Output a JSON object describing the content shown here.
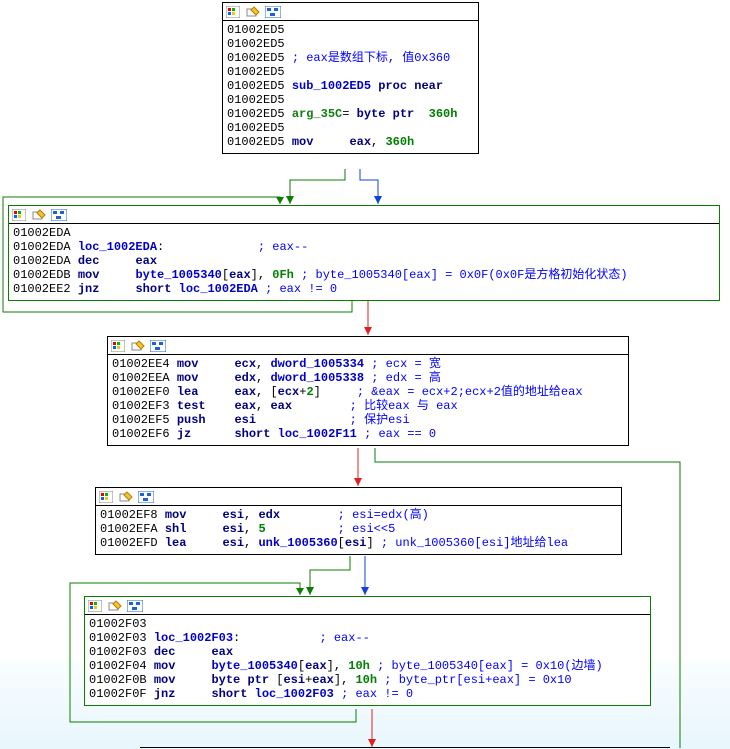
{
  "nodes": {
    "n1": {
      "lines": [
        [
          {
            "t": "01002ED5",
            "c": "addr"
          }
        ],
        [
          {
            "t": "01002ED5",
            "c": "addr"
          }
        ],
        [
          {
            "t": "01002ED5 ",
            "c": "addr"
          },
          {
            "t": "; eax是数组下标, 值0x360",
            "c": "cmt"
          }
        ],
        [
          {
            "t": "01002ED5",
            "c": "addr"
          }
        ],
        [
          {
            "t": "01002ED5 ",
            "c": "addr"
          },
          {
            "t": "sub_1002ED5",
            "c": "lbl"
          },
          {
            "t": " ",
            "c": "addr"
          },
          {
            "t": "proc near",
            "c": "op"
          }
        ],
        [
          {
            "t": "01002ED5",
            "c": "addr"
          }
        ],
        [
          {
            "t": "01002ED5 ",
            "c": "addr"
          },
          {
            "t": "arg_35C",
            "c": "arg"
          },
          {
            "t": "= ",
            "c": "addr"
          },
          {
            "t": "byte ptr",
            "c": "op"
          },
          {
            "t": "  ",
            "c": "addr"
          },
          {
            "t": "360h",
            "c": "num"
          }
        ],
        [
          {
            "t": "01002ED5",
            "c": "addr"
          }
        ],
        [
          {
            "t": "01002ED5 ",
            "c": "addr"
          },
          {
            "t": "mov",
            "c": "op"
          },
          {
            "t": "     ",
            "c": "addr"
          },
          {
            "t": "eax",
            "c": "op"
          },
          {
            "t": ", ",
            "c": "addr"
          },
          {
            "t": "360h",
            "c": "num"
          }
        ]
      ]
    },
    "n2": {
      "lines": [
        [
          {
            "t": "01002EDA",
            "c": "addr"
          }
        ],
        [
          {
            "t": "01002EDA ",
            "c": "addr"
          },
          {
            "t": "loc_1002EDA",
            "c": "lbl"
          },
          {
            "t": ":             ",
            "c": "addr"
          },
          {
            "t": "; eax--",
            "c": "cmt"
          }
        ],
        [
          {
            "t": "01002EDA ",
            "c": "addr"
          },
          {
            "t": "dec",
            "c": "op"
          },
          {
            "t": "     ",
            "c": "addr"
          },
          {
            "t": "eax",
            "c": "op"
          }
        ],
        [
          {
            "t": "01002EDB ",
            "c": "addr"
          },
          {
            "t": "mov",
            "c": "op"
          },
          {
            "t": "     ",
            "c": "addr"
          },
          {
            "t": "byte_1005340",
            "c": "lbl"
          },
          {
            "t": "[",
            "c": "addr"
          },
          {
            "t": "eax",
            "c": "op"
          },
          {
            "t": "], ",
            "c": "addr"
          },
          {
            "t": "0Fh",
            "c": "num"
          },
          {
            "t": " ",
            "c": "addr"
          },
          {
            "t": "; byte_1005340[eax] = 0x0F(0x0F是方格初始化状态)",
            "c": "cmt"
          }
        ],
        [
          {
            "t": "01002EE2 ",
            "c": "addr"
          },
          {
            "t": "jnz",
            "c": "op"
          },
          {
            "t": "     ",
            "c": "addr"
          },
          {
            "t": "short",
            "c": "op"
          },
          {
            "t": " ",
            "c": "addr"
          },
          {
            "t": "loc_1002EDA",
            "c": "lbl"
          },
          {
            "t": " ",
            "c": "addr"
          },
          {
            "t": "; eax != 0",
            "c": "cmt"
          }
        ]
      ]
    },
    "n3": {
      "lines": [
        [
          {
            "t": "01002EE4 ",
            "c": "addr"
          },
          {
            "t": "mov",
            "c": "op"
          },
          {
            "t": "     ",
            "c": "addr"
          },
          {
            "t": "ecx",
            "c": "op"
          },
          {
            "t": ", ",
            "c": "addr"
          },
          {
            "t": "dword_1005334",
            "c": "lbl"
          },
          {
            "t": " ",
            "c": "addr"
          },
          {
            "t": "; ecx = 宽",
            "c": "cmt"
          }
        ],
        [
          {
            "t": "01002EEA ",
            "c": "addr"
          },
          {
            "t": "mov",
            "c": "op"
          },
          {
            "t": "     ",
            "c": "addr"
          },
          {
            "t": "edx",
            "c": "op"
          },
          {
            "t": ", ",
            "c": "addr"
          },
          {
            "t": "dword_1005338",
            "c": "lbl"
          },
          {
            "t": " ",
            "c": "addr"
          },
          {
            "t": "; edx = 高",
            "c": "cmt"
          }
        ],
        [
          {
            "t": "01002EF0 ",
            "c": "addr"
          },
          {
            "t": "lea",
            "c": "op"
          },
          {
            "t": "     ",
            "c": "addr"
          },
          {
            "t": "eax",
            "c": "op"
          },
          {
            "t": ", [",
            "c": "addr"
          },
          {
            "t": "ecx",
            "c": "op"
          },
          {
            "t": "+",
            "c": "addr"
          },
          {
            "t": "2",
            "c": "num"
          },
          {
            "t": "]     ",
            "c": "addr"
          },
          {
            "t": "; &eax = ecx+2;ecx+2值的地址给eax",
            "c": "cmt"
          }
        ],
        [
          {
            "t": "01002EF3 ",
            "c": "addr"
          },
          {
            "t": "test",
            "c": "op"
          },
          {
            "t": "    ",
            "c": "addr"
          },
          {
            "t": "eax",
            "c": "op"
          },
          {
            "t": ", ",
            "c": "addr"
          },
          {
            "t": "eax",
            "c": "op"
          },
          {
            "t": "        ",
            "c": "addr"
          },
          {
            "t": "; 比较eax 与 eax",
            "c": "cmt"
          }
        ],
        [
          {
            "t": "01002EF5 ",
            "c": "addr"
          },
          {
            "t": "push",
            "c": "op"
          },
          {
            "t": "    ",
            "c": "addr"
          },
          {
            "t": "esi",
            "c": "op"
          },
          {
            "t": "             ",
            "c": "addr"
          },
          {
            "t": "; 保护esi",
            "c": "cmt"
          }
        ],
        [
          {
            "t": "01002EF6 ",
            "c": "addr"
          },
          {
            "t": "jz",
            "c": "op"
          },
          {
            "t": "      ",
            "c": "addr"
          },
          {
            "t": "short",
            "c": "op"
          },
          {
            "t": " ",
            "c": "addr"
          },
          {
            "t": "loc_1002F11",
            "c": "lbl"
          },
          {
            "t": " ",
            "c": "addr"
          },
          {
            "t": "; eax == 0",
            "c": "cmt"
          }
        ]
      ]
    },
    "n4": {
      "lines": [
        [
          {
            "t": "01002EF8 ",
            "c": "addr"
          },
          {
            "t": "mov",
            "c": "op"
          },
          {
            "t": "     ",
            "c": "addr"
          },
          {
            "t": "esi",
            "c": "op"
          },
          {
            "t": ", ",
            "c": "addr"
          },
          {
            "t": "edx",
            "c": "op"
          },
          {
            "t": "        ",
            "c": "addr"
          },
          {
            "t": "; esi=edx(高)",
            "c": "cmt"
          }
        ],
        [
          {
            "t": "01002EFA ",
            "c": "addr"
          },
          {
            "t": "shl",
            "c": "op"
          },
          {
            "t": "     ",
            "c": "addr"
          },
          {
            "t": "esi",
            "c": "op"
          },
          {
            "t": ", ",
            "c": "addr"
          },
          {
            "t": "5",
            "c": "num"
          },
          {
            "t": "          ",
            "c": "addr"
          },
          {
            "t": "; esi<<5",
            "c": "cmt"
          }
        ],
        [
          {
            "t": "01002EFD ",
            "c": "addr"
          },
          {
            "t": "lea",
            "c": "op"
          },
          {
            "t": "     ",
            "c": "addr"
          },
          {
            "t": "esi",
            "c": "op"
          },
          {
            "t": ", ",
            "c": "addr"
          },
          {
            "t": "unk_1005360",
            "c": "lbl"
          },
          {
            "t": "[",
            "c": "addr"
          },
          {
            "t": "esi",
            "c": "op"
          },
          {
            "t": "] ",
            "c": "addr"
          },
          {
            "t": "; unk_1005360[esi]地址给lea",
            "c": "cmt"
          }
        ]
      ]
    },
    "n5": {
      "lines": [
        [
          {
            "t": "01002F03",
            "c": "addr"
          }
        ],
        [
          {
            "t": "01002F03 ",
            "c": "addr"
          },
          {
            "t": "loc_1002F03",
            "c": "lbl"
          },
          {
            "t": ":           ",
            "c": "addr"
          },
          {
            "t": "; eax--",
            "c": "cmt"
          }
        ],
        [
          {
            "t": "01002F03 ",
            "c": "addr"
          },
          {
            "t": "dec",
            "c": "op"
          },
          {
            "t": "     ",
            "c": "addr"
          },
          {
            "t": "eax",
            "c": "op"
          }
        ],
        [
          {
            "t": "01002F04 ",
            "c": "addr"
          },
          {
            "t": "mov",
            "c": "op"
          },
          {
            "t": "     ",
            "c": "addr"
          },
          {
            "t": "byte_1005340",
            "c": "lbl"
          },
          {
            "t": "[",
            "c": "addr"
          },
          {
            "t": "eax",
            "c": "op"
          },
          {
            "t": "], ",
            "c": "addr"
          },
          {
            "t": "10h",
            "c": "num"
          },
          {
            "t": " ",
            "c": "addr"
          },
          {
            "t": "; byte_1005340[eax] = 0x10(边墙)",
            "c": "cmt"
          }
        ],
        [
          {
            "t": "01002F0B ",
            "c": "addr"
          },
          {
            "t": "mov",
            "c": "op"
          },
          {
            "t": "     ",
            "c": "addr"
          },
          {
            "t": "byte ptr",
            "c": "op"
          },
          {
            "t": " [",
            "c": "addr"
          },
          {
            "t": "esi",
            "c": "op"
          },
          {
            "t": "+",
            "c": "addr"
          },
          {
            "t": "eax",
            "c": "op"
          },
          {
            "t": "], ",
            "c": "addr"
          },
          {
            "t": "10h",
            "c": "num"
          },
          {
            "t": " ",
            "c": "addr"
          },
          {
            "t": "; byte_ptr[esi+eax] = 0x10",
            "c": "cmt"
          }
        ],
        [
          {
            "t": "01002F0F ",
            "c": "addr"
          },
          {
            "t": "jnz",
            "c": "op"
          },
          {
            "t": "     ",
            "c": "addr"
          },
          {
            "t": "short",
            "c": "op"
          },
          {
            "t": " ",
            "c": "addr"
          },
          {
            "t": "loc_1002F03",
            "c": "lbl"
          },
          {
            "t": " ",
            "c": "addr"
          },
          {
            "t": "; eax != 0",
            "c": "cmt"
          }
        ]
      ]
    }
  }
}
